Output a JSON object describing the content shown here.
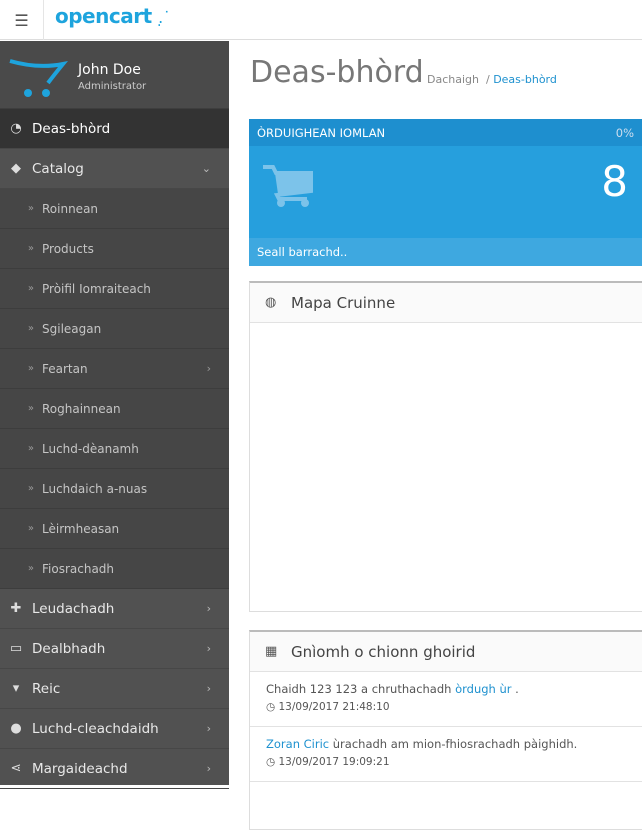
{
  "header": {
    "logo": "opencart",
    "menu_icon": "indent-icon"
  },
  "profile": {
    "name": "John Doe",
    "role": "Administrator"
  },
  "nav": [
    {
      "label": "Deas-bhòrd",
      "icon": "dashboard-icon"
    },
    {
      "label": "Catalog",
      "icon": "tags-icon"
    }
  ],
  "catalog_sub": [
    "Roinnean",
    "Products",
    "Pròifil Iomraiteach",
    "Sgileagan",
    "Feartan",
    "Roghainnean",
    "Luchd-dèanamh",
    "Luchdaich a-nuas",
    "Lèirmheasan",
    "Fiosrachadh"
  ],
  "nav_bottom": [
    {
      "label": "Leudachadh",
      "icon": "puzzle-icon"
    },
    {
      "label": "Dealbhadh",
      "icon": "desktop-icon"
    },
    {
      "label": "Reic",
      "icon": "cart-icon"
    },
    {
      "label": "Luchd-cleachdaidh",
      "icon": "user-icon"
    },
    {
      "label": "Margaideachd",
      "icon": "share-icon"
    }
  ],
  "page": {
    "title": "Deas-bhòrd",
    "breadcrumb": [
      "Dachaigh",
      "Deas-bhòrd"
    ]
  },
  "tile": {
    "title": "ÒRDUIGHEAN IOMLAN",
    "percent": "0%",
    "value": "8",
    "footer": "Seall barrachd.."
  },
  "map": {
    "title": "Mapa Cruinne"
  },
  "activity": {
    "title": "Gnìomh o chionn ghoirid",
    "items": [
      {
        "pre": "Chaidh 123 123 a chruthachadh ",
        "link": "òrdugh ùr",
        "post": " .",
        "time": "13/09/2017 21:48:10"
      },
      {
        "pre": "",
        "link": "Zoran Ciric",
        "post": " ùrachadh am mion-fhiosrachadh pàighidh.",
        "time": "13/09/2017 19:09:21"
      }
    ]
  }
}
